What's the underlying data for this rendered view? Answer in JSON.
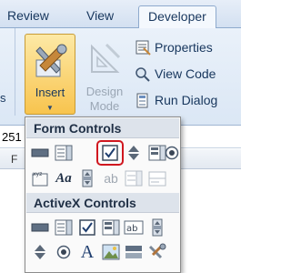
{
  "ribbon": {
    "tabs": [
      {
        "label": "Review"
      },
      {
        "label": "View"
      },
      {
        "label": "Developer",
        "active": true
      }
    ],
    "left_fragment": "s",
    "insert_button": {
      "label": "Insert"
    },
    "design_mode_button": {
      "line1": "Design",
      "line2": "Mode",
      "enabled": false
    },
    "small_buttons": {
      "properties": "Properties",
      "view_code": "View Code",
      "run_dialog": "Run Dialog"
    }
  },
  "sheet": {
    "formula_fragment": "251",
    "column_letter": "F"
  },
  "dropdown": {
    "form_controls_title": "Form Controls",
    "activex_controls_title": "ActiveX Controls",
    "form_controls": [
      "button-icon",
      "combo-box-icon",
      "checkbox-icon",
      "spin-button-icon",
      "list-box-icon",
      "option-button-icon",
      "group-box-icon",
      "label-icon",
      "scroll-bar-icon",
      "text-field-icon",
      "combo-list-edit-icon",
      "combo-drop-down-edit-icon"
    ],
    "activex_controls": [
      "command-button-icon",
      "combo-box-icon",
      "checkbox-icon",
      "list-box-icon",
      "text-box-icon",
      "scroll-bar-icon",
      "spin-button-icon",
      "option-button-icon",
      "label-icon",
      "image-icon",
      "toggle-button-icon",
      "more-controls-icon"
    ],
    "text_glyphs": {
      "label_aa": "Aa",
      "text_ab": "ab",
      "label_a": "A"
    },
    "selected_control": "checkbox-icon"
  },
  "colors": {
    "highlight": "#d0171f",
    "insert_active": "#f8c44e",
    "text": "#17365d"
  }
}
